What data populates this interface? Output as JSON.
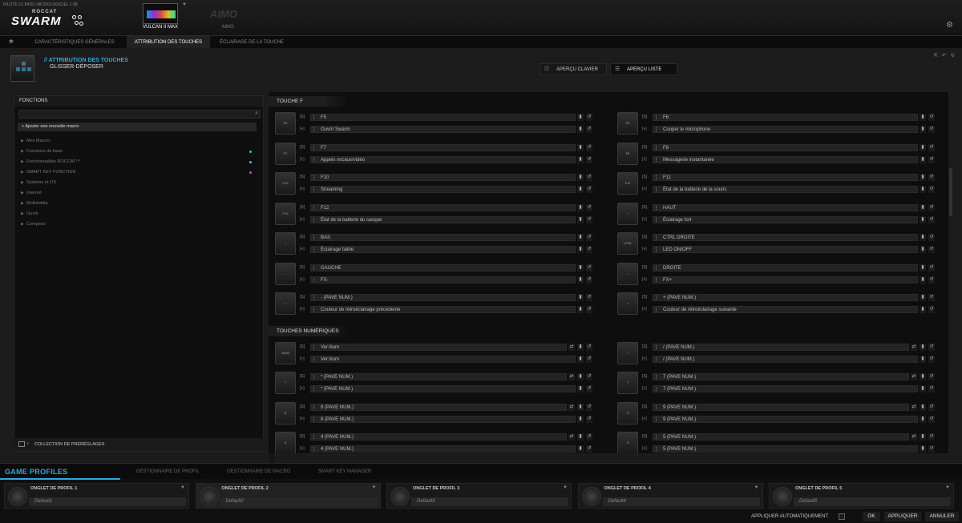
{
  "app": {
    "version": "PILOTE V1.8429 | MICROLOGICIEL 1.08",
    "brand_small": "ROCCAT",
    "brand": "SWARM",
    "devices": [
      {
        "name": "VULCAN II MAX",
        "active": true
      },
      {
        "name": "AIMO",
        "logo_text": "AIMO",
        "active": false
      }
    ]
  },
  "main_tabs": [
    {
      "label": "CARACTÉRISTIQUES GÉNÉRALES",
      "active": false
    },
    {
      "label": "ATTRIBUTION DES TOUCHES",
      "active": true
    },
    {
      "label": "ÉCLAIRAGE DE LA TOUCHE",
      "active": false
    }
  ],
  "header": {
    "title": "// ATTRIBUTION DES TOUCHES",
    "subtitle": "GLISSER-DÉPOSER",
    "view_buttons": [
      {
        "label": "APERÇU CLAVIER",
        "icon": "grid-icon",
        "active": false
      },
      {
        "label": "APERÇU LISTE",
        "icon": "list-icon",
        "active": true
      }
    ]
  },
  "functions": {
    "title": "FONCTIONS",
    "add_macro": "+ Ajouter une nouvelle macro",
    "items": [
      {
        "label": "Mes Macros",
        "dot": ""
      },
      {
        "label": "Fonctions de base",
        "dot": "#37c6e8"
      },
      {
        "label": "Fonctionnalités ROCCAT™",
        "dot": "#37c6e8"
      },
      {
        "label": "SMART KEY FUNCTION",
        "dot": "#e83ac0"
      },
      {
        "label": "Système et OS",
        "dot": ""
      },
      {
        "label": "Internet",
        "dot": ""
      },
      {
        "label": "Multimédia",
        "dot": ""
      },
      {
        "label": "Ouvrir",
        "dot": ""
      },
      {
        "label": "Compteur",
        "dot": ""
      }
    ],
    "presets": "COLLECTION DE PRÉRÉGLAGES"
  },
  "sections": [
    {
      "title": "TOUCHE F",
      "entries": [
        {
          "cap": "F5",
          "primary": "F5",
          "secondary": "Ouvrir Swarm"
        },
        {
          "cap": "F6",
          "primary": "F6",
          "secondary": "Couper le microphone"
        },
        {
          "cap": "F7",
          "primary": "F7",
          "secondary": "Appels vocaux/vidéo"
        },
        {
          "cap": "F8",
          "primary": "F8",
          "secondary": "Messagerie instantanée"
        },
        {
          "cap": "F10",
          "primary": "F10",
          "secondary": "Streaming"
        },
        {
          "cap": "F11",
          "primary": "F11",
          "secondary": "État de la batterie de la souris"
        },
        {
          "cap": "F12",
          "primary": "F12",
          "secondary": "État de la batterie du casque"
        },
        {
          "cap": "↑",
          "primary": "HAUT",
          "secondary": "Éclairage fort"
        },
        {
          "cap": "↓",
          "primary": "BAS",
          "secondary": "Éclairage faible"
        },
        {
          "cap": "CTRL",
          "primary": "CTRL DROITE",
          "secondary": "LED ON/OFF"
        },
        {
          "cap": "←",
          "primary": "GAUCHE",
          "secondary": "FX-"
        },
        {
          "cap": "→",
          "primary": "DROITE",
          "secondary": "FX+"
        },
        {
          "cap": "−",
          "primary": "- (PAVE NUM.)",
          "secondary": "Couleur de rétroéclairage précédente"
        },
        {
          "cap": "+",
          "primary": "+ (PAVE NUM.)",
          "secondary": "Couleur de rétroéclairage suivante"
        }
      ]
    },
    {
      "title": "TOUCHES NUMÉRIQUES",
      "entries": [
        {
          "cap": "NUM",
          "primary": "Ver.Num",
          "secondary": "Ver.Num",
          "swap": true
        },
        {
          "cap": "/",
          "primary": "/ (PAVE NUM.)",
          "secondary": "/ (PAVE NUM.)",
          "swap": true
        },
        {
          "cap": "*",
          "primary": "* (PAVE NUM.)",
          "secondary": "* (PAVE NUM.)",
          "swap": true
        },
        {
          "cap": "7",
          "primary": "7 (PAVE NUM.)",
          "secondary": "7 (PAVE NUM.)",
          "swap": true
        },
        {
          "cap": "8",
          "primary": "8 (PAVE NUM.)",
          "secondary": "8 (PAVE NUM.)",
          "swap": true
        },
        {
          "cap": "9",
          "primary": "9 (PAVE NUM.)",
          "secondary": "9 (PAVE NUM.)",
          "swap": true
        },
        {
          "cap": "4",
          "primary": "4 (PAVE NUM.)",
          "secondary": "4 (PAVE NUM.)",
          "swap": true
        },
        {
          "cap": "5",
          "primary": "5 (PAVE NUM.)",
          "secondary": "5 (PAVE NUM.)",
          "swap": true
        }
      ]
    }
  ],
  "row_prefix": {
    "primary": "[S]",
    "secondary": "[+]"
  },
  "bottom": {
    "title": "GAME PROFILES",
    "tabs": [
      "GESTIONNAIRE DE PROFIL",
      "GESTIONNAIRE DE MACRO",
      "SMART KEY MANAGER"
    ],
    "profiles": [
      {
        "tab": "ONGLET DE PROFIL 1",
        "name": "Default1",
        "active": false
      },
      {
        "tab": "ONGLET DE PROFIL 2",
        "name": "Default2",
        "active": true
      },
      {
        "tab": "ONGLET DE PROFIL 3",
        "name": "Default3",
        "active": false
      },
      {
        "tab": "ONGLET DE PROFIL 4",
        "name": "Default4",
        "active": false
      },
      {
        "tab": "ONGLET DE PROFIL 5",
        "name": "Default5",
        "active": false
      }
    ],
    "auto_apply": "APPLIQUER AUTOMATIQUEMENT",
    "buttons": {
      "ok": "OK",
      "apply": "APPLIQUER",
      "cancel": "ANNULER"
    }
  },
  "colors": {
    "accent": "#2fa7e0"
  }
}
